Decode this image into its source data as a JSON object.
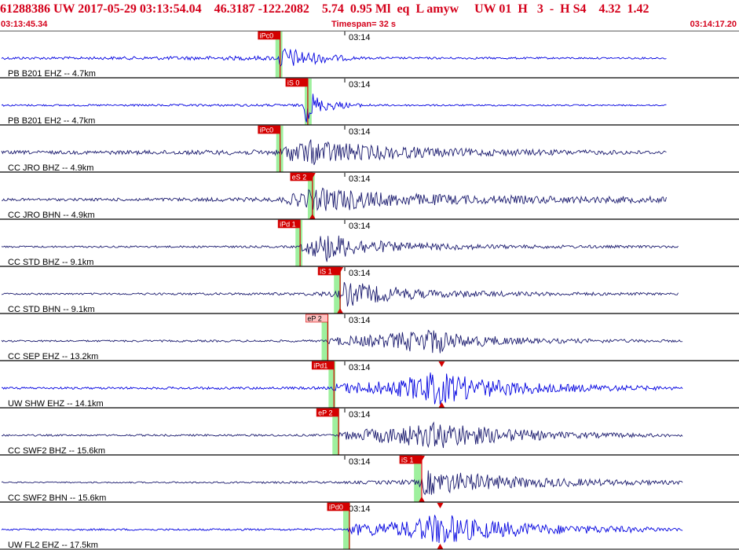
{
  "header": {
    "title": "61288386 UW 2017-05-29 03:13:54.04    46.3187 -122.2082    5.74  0.95 Ml  eq  L amyw     UW 01  H   3  -  H S4    4.32  1.42",
    "start_time": "03:13:45.34",
    "timespan_label": "Timespan=",
    "timespan_value": "32 s",
    "end_time": "03:14:17.20"
  },
  "tick_label": "03:14",
  "colors": {
    "pick_red": "#d40000",
    "pick_pink": "#ffc0c0",
    "pick_green": "#9ef09e",
    "trace_blue": "#0000e0",
    "trace_navy": "#1a1a6e",
    "divider": "#000000",
    "header_red": "#d4001a"
  },
  "traces": [
    {
      "label": "PB B201 EHZ -- 4.7km",
      "color": "blue",
      "p_label": "iPc0",
      "p_style": "red",
      "p_time": 3.4,
      "s_label": "",
      "s_time": null,
      "green": [
        3.1,
        3.55
      ],
      "env": [
        [
          -10,
          0.06
        ],
        [
          3.3,
          0.1
        ],
        [
          3.4,
          0.55
        ],
        [
          5.2,
          0.3
        ],
        [
          7.5,
          0.12
        ],
        [
          9,
          0.05
        ],
        [
          28,
          0.04
        ]
      ],
      "end": 28.5
    },
    {
      "label": "PB B201 EH2 -- 4.7km",
      "color": "blue",
      "p_label": "",
      "p_time": null,
      "s_label": "iS 0",
      "s_style": "red",
      "s_time": 5.2,
      "green": [
        5.0,
        5.45
      ],
      "env": [
        [
          -10,
          0.04
        ],
        [
          4.9,
          0.06
        ],
        [
          5.1,
          0.85
        ],
        [
          6.0,
          0.3
        ],
        [
          8,
          0.1
        ],
        [
          10,
          0.04
        ],
        [
          28,
          0.03
        ]
      ],
      "end": 28.5
    },
    {
      "label": "CC JRO BHZ -- 4.9km",
      "color": "navy",
      "p_label": "iPc0",
      "p_style": "red",
      "p_time": 3.4,
      "s_label": "",
      "s_time": null,
      "green": [
        3.15,
        3.6
      ],
      "env": [
        [
          -10,
          0.08
        ],
        [
          3.35,
          0.12
        ],
        [
          3.6,
          0.35
        ],
        [
          5.5,
          0.6
        ],
        [
          9,
          0.35
        ],
        [
          15,
          0.18
        ],
        [
          22,
          0.12
        ],
        [
          28,
          0.08
        ]
      ],
      "end": 28.5
    },
    {
      "label": "CC JRO BHN -- 4.9km",
      "color": "navy",
      "p_label": "",
      "p_time": null,
      "s_label": "eS 2",
      "s_style": "red",
      "s_time": 5.5,
      "s_mark": true,
      "green": [
        5.2,
        5.65
      ],
      "env": [
        [
          -10,
          0.06
        ],
        [
          3.3,
          0.1
        ],
        [
          5.5,
          0.5
        ],
        [
          7,
          0.55
        ],
        [
          10,
          0.32
        ],
        [
          16,
          0.2
        ],
        [
          28,
          0.14
        ]
      ],
      "end": 28.5
    },
    {
      "label": "CC STD BHZ -- 9.1km",
      "color": "navy",
      "p_label": "iPd 1",
      "p_style": "red",
      "p_time": 4.7,
      "s_label": "",
      "s_time": null,
      "green": [
        4.4,
        4.85
      ],
      "env": [
        [
          -10,
          0.04
        ],
        [
          4.6,
          0.05
        ],
        [
          5.0,
          0.3
        ],
        [
          6.5,
          0.7
        ],
        [
          8,
          0.4
        ],
        [
          11,
          0.2
        ],
        [
          18,
          0.09
        ],
        [
          29,
          0.05
        ]
      ],
      "end": 29.3
    },
    {
      "label": "CC STD BHN -- 9.1km",
      "color": "navy",
      "p_label": "",
      "p_time": null,
      "s_label": "iS 1",
      "s_style": "red",
      "s_time": 7.3,
      "s_mark": true,
      "green": [
        6.9,
        7.35
      ],
      "env": [
        [
          -10,
          0.04
        ],
        [
          4.7,
          0.06
        ],
        [
          7.2,
          0.15
        ],
        [
          7.5,
          0.6
        ],
        [
          9.5,
          0.4
        ],
        [
          13,
          0.18
        ],
        [
          20,
          0.09
        ],
        [
          29,
          0.05
        ]
      ],
      "end": 29.3
    },
    {
      "label": "CC SEP EHZ -- 13.2km",
      "color": "navy",
      "p_label": "eP 2",
      "p_style": "pink",
      "p_time": 6.5,
      "s_label": "",
      "s_time": null,
      "green": [
        6.1,
        6.55
      ],
      "env": [
        [
          -10,
          0.04
        ],
        [
          6.4,
          0.05
        ],
        [
          6.7,
          0.18
        ],
        [
          10,
          0.3
        ],
        [
          13.5,
          0.62
        ],
        [
          15,
          0.3
        ],
        [
          20,
          0.12
        ],
        [
          29.5,
          0.05
        ]
      ],
      "end": 29.6
    },
    {
      "label": "UW SHW EHZ -- 14.1km",
      "color": "blue",
      "p_label": "iPd1",
      "p_style": "red",
      "p_time": 6.9,
      "s_label": "",
      "s_time": null,
      "s_triangle": 13.9,
      "green": [
        6.55,
        7.0
      ],
      "env": [
        [
          -10,
          0.05
        ],
        [
          6.8,
          0.06
        ],
        [
          7.0,
          0.22
        ],
        [
          11,
          0.35
        ],
        [
          13.5,
          0.8
        ],
        [
          16,
          0.45
        ],
        [
          21,
          0.2
        ],
        [
          29.5,
          0.07
        ]
      ],
      "end": 29.6
    },
    {
      "label": "CC SWF2 BHZ -- 15.6km",
      "color": "navy",
      "p_label": "eP 2",
      "p_style": "red",
      "p_time": 7.2,
      "s_label": "",
      "s_time": null,
      "green": [
        6.8,
        7.25
      ],
      "env": [
        [
          -10,
          0.04
        ],
        [
          7.1,
          0.05
        ],
        [
          7.4,
          0.18
        ],
        [
          11,
          0.4
        ],
        [
          14,
          0.62
        ],
        [
          17,
          0.35
        ],
        [
          22,
          0.15
        ],
        [
          29.5,
          0.06
        ]
      ],
      "end": 29.6
    },
    {
      "label": "CC SWF2 BHN -- 15.6km",
      "color": "navy",
      "p_label": "",
      "p_time": null,
      "s_label": "iS 1",
      "s_style": "red",
      "s_time": 12.6,
      "s_mark": true,
      "green": [
        12.1,
        12.55
      ],
      "env": [
        [
          -10,
          0.03
        ],
        [
          7.2,
          0.05
        ],
        [
          12.4,
          0.12
        ],
        [
          12.8,
          0.6
        ],
        [
          15,
          0.45
        ],
        [
          19,
          0.25
        ],
        [
          24,
          0.15
        ],
        [
          29.5,
          0.08
        ]
      ],
      "end": 29.6
    },
    {
      "label": "UW FL2 EHZ -- 17.5km",
      "color": "blue",
      "p_label": "iPd0",
      "p_style": "red",
      "p_time": 7.9,
      "s_label": "",
      "s_time": null,
      "s_triangle": 13.8,
      "green": [
        7.5,
        7.95
      ],
      "env": [
        [
          -10,
          0.04
        ],
        [
          7.8,
          0.05
        ],
        [
          8.0,
          0.25
        ],
        [
          12,
          0.4
        ],
        [
          13.8,
          0.78
        ],
        [
          16,
          0.45
        ],
        [
          21,
          0.22
        ],
        [
          29.5,
          0.08
        ]
      ],
      "end": 29.6
    }
  ]
}
